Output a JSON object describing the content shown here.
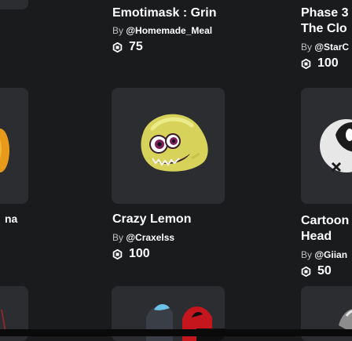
{
  "items": [
    {
      "name": "Emotimask : Grin",
      "by_prefix": "By ",
      "creator": "@Homemade_Meal",
      "price": "75"
    },
    {
      "name": "Phase 3",
      "name2": "The Clo",
      "by_prefix": "By ",
      "creator": "@StarC",
      "price": "100"
    },
    {
      "name": "Crazy Lemon",
      "by_prefix": "By ",
      "creator": "@Craxelss",
      "price": "100"
    },
    {
      "name": "Cartoon",
      "name2": "Head",
      "by_prefix": "By ",
      "creator": "@Giian",
      "price": "50"
    },
    {
      "name_fragment": "na"
    }
  ],
  "colors": {
    "background": "#191b1d",
    "card": "#2b2d31",
    "text": "#ffffff",
    "muted": "#bdbebe"
  }
}
